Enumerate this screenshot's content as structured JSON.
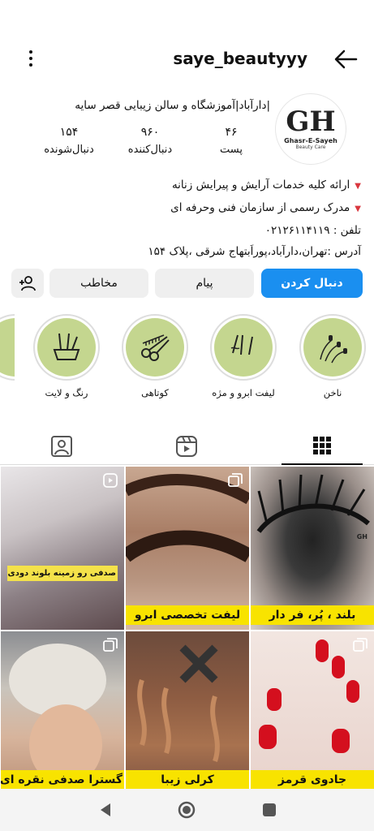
{
  "header": {
    "username": "saye_beautyyy"
  },
  "profile": {
    "avatar_logo": {
      "monogram": "GH",
      "name": "Ghasr-E-Sayeh",
      "tagline": "Beauty Care"
    },
    "display_name": "|دارآباد|آموزشگاه و سالن زیبایی قصر سایه",
    "stats": [
      {
        "value": "۴۶",
        "label": "پست"
      },
      {
        "value": "۹۶۰",
        "label": "دنبال‌کننده"
      },
      {
        "value": "۱۵۴",
        "label": "دنبال‌شونده"
      }
    ],
    "bio": {
      "line1": "ارائه کلیه خدمات آرایش و پیرایش زنانه",
      "line2": "مدرک رسمی از سازمان فنی وحرفه ای",
      "phone": "تلفن : ۰۲۱۲۶۱۱۴۱۱۹",
      "address": "آدرس :تهران،دارآباد،پوراَبتهاج شرقی ،پلاک ۱۵۴"
    }
  },
  "buttons": {
    "follow": "دنبال کردن",
    "message": "پیام",
    "contact": "مخاطب"
  },
  "highlights": [
    {
      "label": "ناخن",
      "icon": "nails-icon"
    },
    {
      "label": "لیفت ابرو و مژه",
      "icon": "lash-tools-icon"
    },
    {
      "label": "کوتاهی",
      "icon": "scissors-comb-icon"
    },
    {
      "label": "رنگ و لایت",
      "icon": "hair-dye-bowl-icon"
    }
  ],
  "tabs": [
    "grid-icon",
    "reels-icon",
    "tagged-icon"
  ],
  "posts": [
    {
      "caption": "بلند ، پُر، فر دار",
      "style": "eyelashes",
      "badge": "",
      "watermark": "GH"
    },
    {
      "caption": "لیفت تخصصی ابرو",
      "style": "brows",
      "badge": "multi",
      "watermark": ""
    },
    {
      "caption": "صدفی رو زمینه بلوند دودی",
      "style": "blonde",
      "badge": "reel",
      "watermark": ""
    },
    {
      "caption": "جادوی قرمز",
      "style": "red-nails",
      "badge": "multi",
      "watermark": ""
    },
    {
      "caption": "کرلی زیبا",
      "style": "curly",
      "badge": "",
      "watermark": ""
    },
    {
      "caption": "گسترا صدفی نقره ای",
      "style": "short-hair",
      "badge": "multi",
      "watermark": ""
    }
  ],
  "colors": {
    "accent": "#1a8ff0",
    "highlight_bg": "#c4d68f",
    "caption_bg": "#f8e300"
  }
}
